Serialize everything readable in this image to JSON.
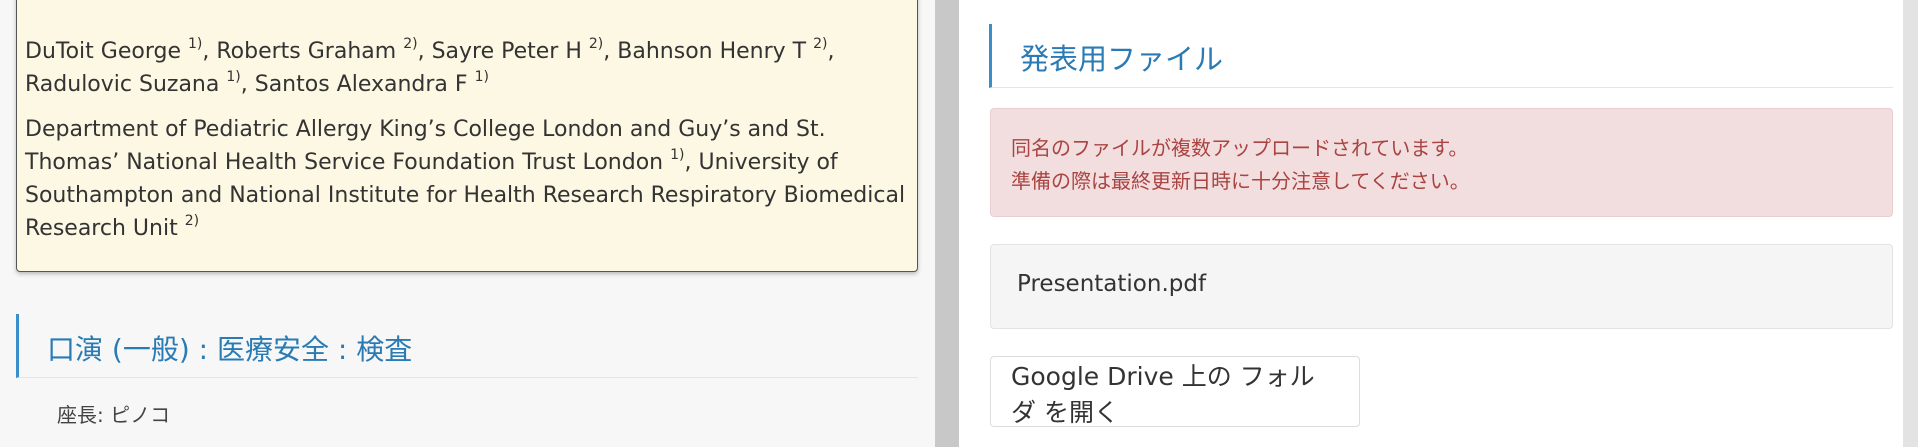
{
  "abstract": {
    "authors": [
      {
        "name": "DuToit George",
        "sup": "1)",
        "sep": ", "
      },
      {
        "name": "Roberts Graham",
        "sup": "2)",
        "sep": ", "
      },
      {
        "name": "Sayre Peter H",
        "sup": "2)",
        "sep": ", "
      },
      {
        "name": "Bahnson Henry T",
        "sup": "2)",
        "sep": ", "
      },
      {
        "name": "Radulovic Suzana",
        "sup": "1)",
        "sep": ", "
      },
      {
        "name": "Santos Alexandra F",
        "sup": "1)",
        "sep": ""
      }
    ],
    "affiliations": [
      {
        "name": "Department of Pediatric Allergy King’s College London and Guy’s and St. Thomas’ National Health Service Foundation Trust London",
        "sup": "1)",
        "sep": ", "
      },
      {
        "name": "University of Southampton and National Institute for Health Research Respiratory Biomedical Research Unit",
        "sup": "2)",
        "sep": ""
      }
    ]
  },
  "session": {
    "title": "口演 (一般) : 医療安全 : 検査",
    "chair": "座長: ピノコ"
  },
  "files_panel": {
    "title": "発表用ファイル",
    "alert_lines": [
      "同名のファイルが複数アップロードされています。",
      "準備の際は最終更新日時に十分注意してください。"
    ],
    "file_name": "Presentation.pdf",
    "drive_button_label": "Google Drive 上の フォルダ を開く"
  }
}
